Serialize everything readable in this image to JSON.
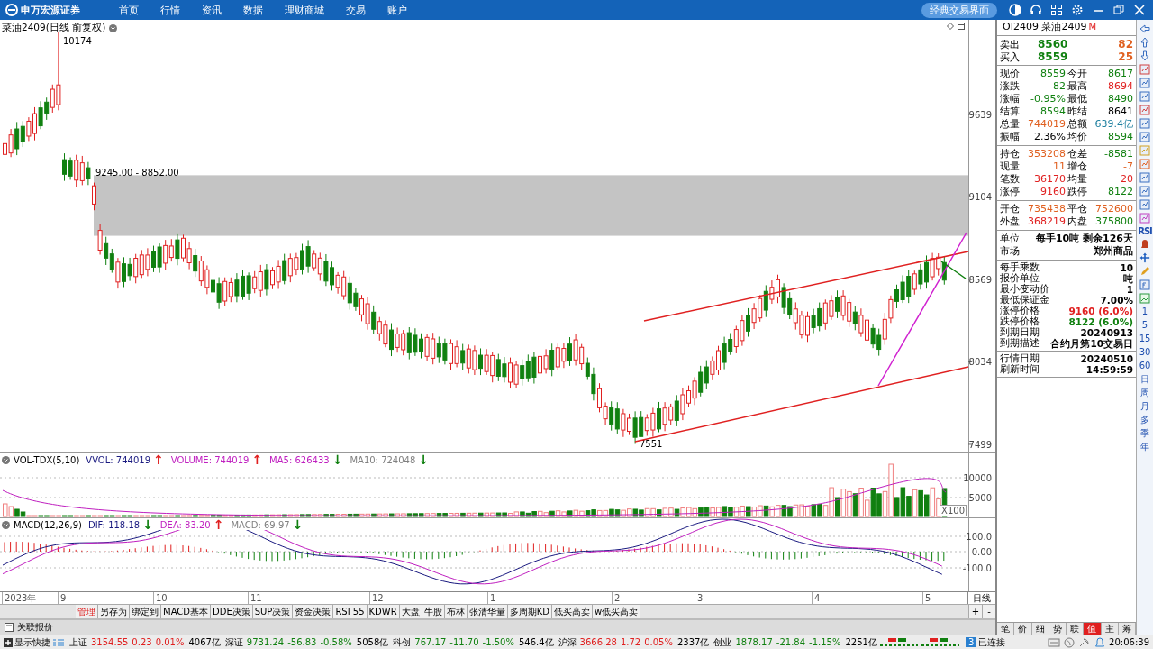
{
  "topbar": {
    "logo": "申万宏源证券",
    "menu": [
      {
        "label": "首页"
      },
      {
        "label": "行情"
      },
      {
        "label": "资讯"
      },
      {
        "label": "数据"
      },
      {
        "label": "理财商城"
      },
      {
        "label": "交易"
      },
      {
        "label": "账户"
      }
    ],
    "mode_button": "经典交易界面"
  },
  "chart": {
    "title": "菜油2409(日线 前复权)",
    "high_label": "10174",
    "low_label": "7551",
    "range_label": "9245.00 - 8852.00",
    "price_ticks": [
      "9639",
      "9104",
      "8569",
      "8034",
      "7499"
    ],
    "volume": {
      "name": "VOL-TDX(5,10)",
      "items": [
        {
          "label": "VVOL: 744019",
          "color": "#1a1a80",
          "arrow": {
            "symbol": "↑",
            "color": "#e02020"
          }
        },
        {
          "label": "VOLUME: 744019",
          "color": "#c020c0",
          "arrow": {
            "symbol": "↑",
            "color": "#e02020"
          }
        },
        {
          "label": "MA5: 626433",
          "color": "#c020c0",
          "arrow": {
            "symbol": "↓",
            "color": "#108010"
          }
        },
        {
          "label": "MA10: 724048",
          "color": "#808080",
          "arrow": {
            "symbol": "↓",
            "color": "#108010"
          }
        }
      ],
      "ticks": [
        "10000",
        "5000"
      ],
      "unit": "X100"
    },
    "macd": {
      "name": "MACD(12,26,9)",
      "items": [
        {
          "label": "DIF: 118.18",
          "color": "#1a1a80",
          "arrow": {
            "symbol": "↓",
            "color": "#108010"
          }
        },
        {
          "label": "DEA: 83.20",
          "color": "#c020c0",
          "arrow": {
            "symbol": "↑",
            "color": "#e02020"
          }
        },
        {
          "label": "MACD: 69.97",
          "color": "#808080",
          "arrow": {
            "symbol": "↓",
            "color": "#108010"
          }
        }
      ],
      "ticks": [
        "100.0",
        "0.00",
        "-100.0"
      ]
    },
    "dates": [
      "2023年",
      "9",
      "10",
      "11",
      "12",
      "1",
      "2",
      "3",
      "4",
      "5"
    ],
    "period": "日线"
  },
  "tabs": [
    {
      "label": "管理",
      "selected": true
    },
    {
      "label": "另存为",
      "selected": false
    },
    {
      "label": "绑定到",
      "selected": false
    },
    {
      "label": "MACD基本",
      "selected": false
    },
    {
      "label": "DDE决策",
      "selected": false
    },
    {
      "label": "SUP决策",
      "selected": false
    },
    {
      "label": "资金决策",
      "selected": false
    },
    {
      "label": "RSI 55",
      "selected": false
    },
    {
      "label": "KDWR",
      "selected": false
    },
    {
      "label": "大盘",
      "selected": false
    },
    {
      "label": "牛股",
      "selected": false
    },
    {
      "label": "布林",
      "selected": false
    },
    {
      "label": "张清华量",
      "selected": false
    },
    {
      "label": "多周期KD",
      "selected": false
    },
    {
      "label": "低买高卖",
      "selected": false
    },
    {
      "label": "w低买高卖",
      "selected": false
    }
  ],
  "zoom_buttons": [
    "+",
    "-"
  ],
  "related": {
    "label": "关联报价"
  },
  "quote": {
    "code": "OI2409",
    "name": "菜油2409",
    "badge": "M",
    "orders": [
      {
        "label": "卖出",
        "price": "8560",
        "volume": "82"
      },
      {
        "label": "买入",
        "price": "8559",
        "volume": "25"
      }
    ],
    "groups": [
      {
        "kind": "pairs",
        "rows": [
          {
            "cells": [
              {
                "label": "现价",
                "value": "8559",
                "color": "#108010"
              },
              {
                "label": "今开",
                "value": "8617",
                "color": "#108010"
              }
            ]
          },
          {
            "cells": [
              {
                "label": "涨跌",
                "value": "-82",
                "color": "#108010"
              },
              {
                "label": "最高",
                "value": "8694",
                "color": "#e02020"
              }
            ]
          },
          {
            "cells": [
              {
                "label": "涨幅",
                "value": "-0.95%",
                "color": "#108010"
              },
              {
                "label": "最低",
                "value": "8490",
                "color": "#108010"
              }
            ]
          },
          {
            "cells": [
              {
                "label": "结算",
                "value": "8594",
                "color": "#108010"
              },
              {
                "label": "昨结",
                "value": "8641",
                "color": "#000000"
              }
            ]
          },
          {
            "cells": [
              {
                "label": "总量",
                "value": "744019",
                "color": "#e06020"
              },
              {
                "label": "总额",
                "value": "639.4亿",
                "color": "#2080a0"
              }
            ]
          },
          {
            "cells": [
              {
                "label": "振幅",
                "value": "2.36%",
                "color": "#000000"
              },
              {
                "label": "均价",
                "value": "8594",
                "color": "#108010"
              }
            ]
          }
        ]
      },
      {
        "kind": "pairs",
        "rows": [
          {
            "cells": [
              {
                "label": "持仓",
                "value": "353208",
                "color": "#e06020"
              },
              {
                "label": "仓差",
                "value": "-8581",
                "color": "#108010"
              }
            ]
          },
          {
            "cells": [
              {
                "label": "现量",
                "value": "11",
                "color": "#e06020"
              },
              {
                "label": "增仓",
                "value": "-7",
                "color": "#e06020"
              }
            ]
          },
          {
            "cells": [
              {
                "label": "笔数",
                "value": "36170",
                "color": "#e02020"
              },
              {
                "label": "均量",
                "value": "20",
                "color": "#e02020"
              }
            ]
          },
          {
            "cells": [
              {
                "label": "涨停",
                "value": "9160",
                "color": "#e02020"
              },
              {
                "label": "跌停",
                "value": "8122",
                "color": "#108010"
              }
            ]
          }
        ]
      },
      {
        "kind": "pairs",
        "rows": [
          {
            "cells": [
              {
                "label": "开仓",
                "value": "735438",
                "color": "#e06020"
              },
              {
                "label": "平仓",
                "value": "752600",
                "color": "#e06020"
              }
            ]
          },
          {
            "cells": [
              {
                "label": "外盘",
                "value": "368219",
                "color": "#e02020"
              },
              {
                "label": "内盘",
                "value": "375800",
                "color": "#108010"
              }
            ]
          }
        ]
      },
      {
        "kind": "wide",
        "rows": [
          {
            "label": "单位",
            "value": "每手10吨 剩余126天",
            "color": "#000000"
          },
          {
            "label": "市场",
            "value": "郑州商品",
            "color": "#000000"
          }
        ]
      },
      {
        "kind": "dense",
        "rows": [
          {
            "label": "每手乘数",
            "value": "10",
            "color": "#000000"
          },
          {
            "label": "报价单位",
            "value": "吨",
            "color": "#000000"
          },
          {
            "label": "最小变动价",
            "value": "1",
            "color": "#000000"
          },
          {
            "label": "最低保证金",
            "value": "7.00%",
            "color": "#000000"
          },
          {
            "label": "涨停价格",
            "value": "9160 (6.0%)",
            "color": "#e02020"
          },
          {
            "label": "跌停价格",
            "value": "8122 (6.0%)",
            "color": "#108010"
          },
          {
            "label": "到期日期",
            "value": "20240913",
            "color": "#000000"
          },
          {
            "label": "到期描述",
            "value": "合约月第10交易日",
            "color": "#000000"
          }
        ]
      },
      {
        "kind": "dense",
        "rows": [
          {
            "label": "行情日期",
            "value": "20240510",
            "color": "#000000"
          },
          {
            "label": "刷新时间",
            "value": "14:59:59",
            "color": "#000000"
          }
        ]
      }
    ]
  },
  "panel_tabs": [
    {
      "label": "笔",
      "selected": false
    },
    {
      "label": "价",
      "selected": false
    },
    {
      "label": "细",
      "selected": false
    },
    {
      "label": "势",
      "selected": false
    },
    {
      "label": "联",
      "selected": false
    },
    {
      "label": "值",
      "selected": true
    },
    {
      "label": "主",
      "selected": false
    },
    {
      "label": "筹",
      "selected": false
    }
  ],
  "toolbar": {
    "rsi": "RSI",
    "periods": [
      "1",
      "5",
      "15",
      "30",
      "60",
      "日",
      "周",
      "月",
      "多",
      "季",
      "年"
    ]
  },
  "status": {
    "shortcut": "显示快捷",
    "markets": [
      {
        "name": "上证",
        "value": "3154.55",
        "change": "0.23",
        "pct": "0.01%",
        "amount": "4067亿",
        "color": "#e02020"
      },
      {
        "name": "深证",
        "value": "9731.24",
        "change": "-56.83",
        "pct": "-0.58%",
        "amount": "5058亿",
        "color": "#108010"
      },
      {
        "name": "科创",
        "value": "767.17",
        "change": "-11.70",
        "pct": "-1.50%",
        "amount": "546.4亿",
        "color": "#108010"
      },
      {
        "name": "沪深",
        "value": "3666.28",
        "change": "1.72",
        "pct": "0.05%",
        "amount": "2337亿",
        "color": "#e02020"
      },
      {
        "name": "创业",
        "value": "1878.17",
        "change": "-21.84",
        "pct": "-1.15%",
        "amount": "2251亿",
        "color": "#108010"
      }
    ],
    "connections": "3",
    "connection_text": "已连接",
    "time": "20:06:39"
  }
}
